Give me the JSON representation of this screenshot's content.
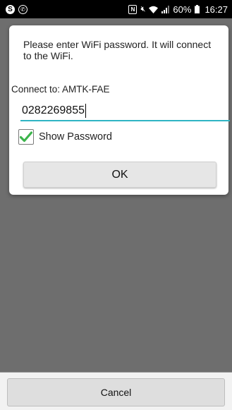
{
  "status_bar": {
    "battery": "60%",
    "time": "16:27",
    "icons": [
      "skype-icon",
      "whatsapp-icon",
      "nfc-icon",
      "mute-icon",
      "wifi-icon",
      "signal-icon",
      "battery-icon"
    ]
  },
  "dialog": {
    "message": "Please enter WiFi password. It will connect to the WiFi.",
    "connect_label": "Connect to: AMTK-FAE",
    "password_value": "0282269855",
    "show_password_label": "Show Password",
    "show_password_checked": true,
    "ok_label": "OK"
  },
  "bottom": {
    "cancel_label": "Cancel"
  },
  "colors": {
    "accent": "#2fb4c4",
    "check": "#3cb44b",
    "overlay": "#6e6e6e"
  }
}
